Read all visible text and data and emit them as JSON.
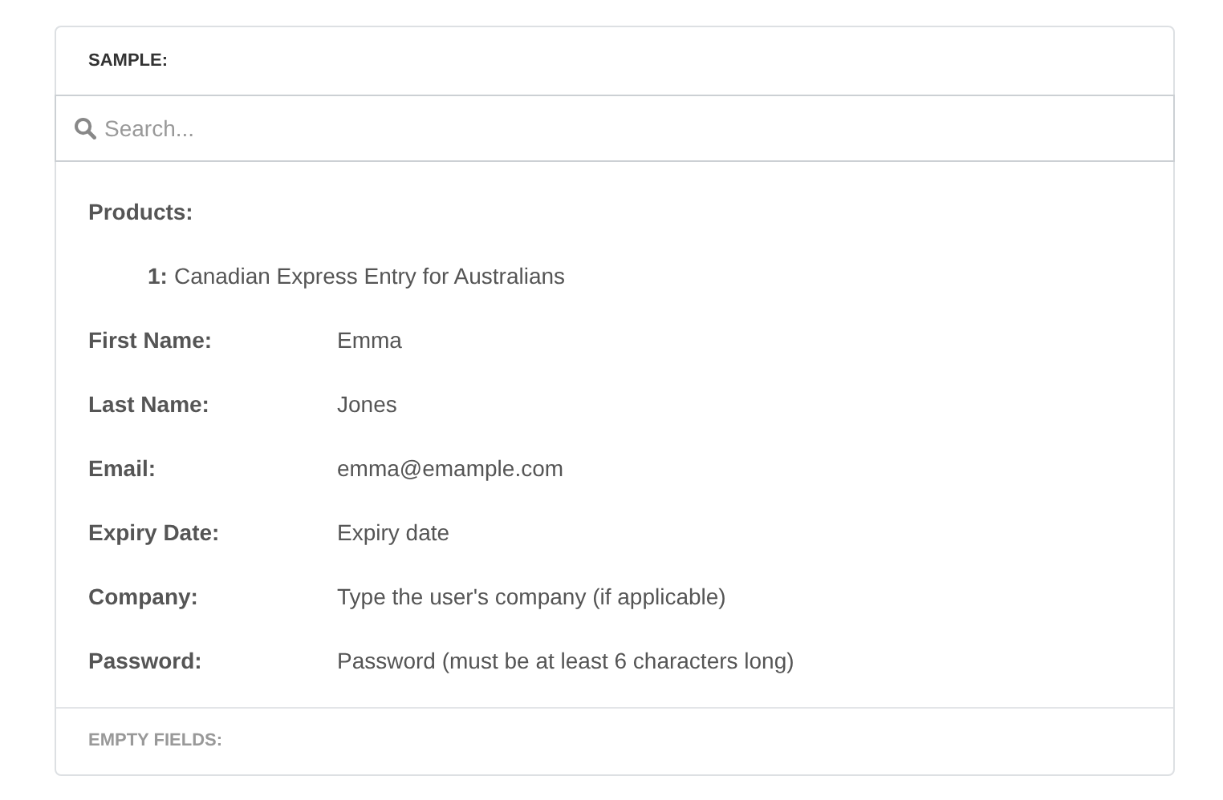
{
  "header": {
    "title": "SAMPLE:"
  },
  "search": {
    "placeholder": "Search..."
  },
  "products": {
    "label": "Products:",
    "items": [
      {
        "index": "1:",
        "name": "Canadian Express Entry for Australians"
      }
    ]
  },
  "fields": [
    {
      "label": "First Name:",
      "value": "Emma"
    },
    {
      "label": "Last Name:",
      "value": "Jones"
    },
    {
      "label": "Email:",
      "value": "emma@emample.com"
    },
    {
      "label": "Expiry Date:",
      "value": "Expiry date"
    },
    {
      "label": "Company:",
      "value": "Type the user's company (if applicable)"
    },
    {
      "label": "Password:",
      "value": "Password (must be at least 6 characters long)"
    }
  ],
  "footer": {
    "title": "EMPTY FIELDS:"
  }
}
